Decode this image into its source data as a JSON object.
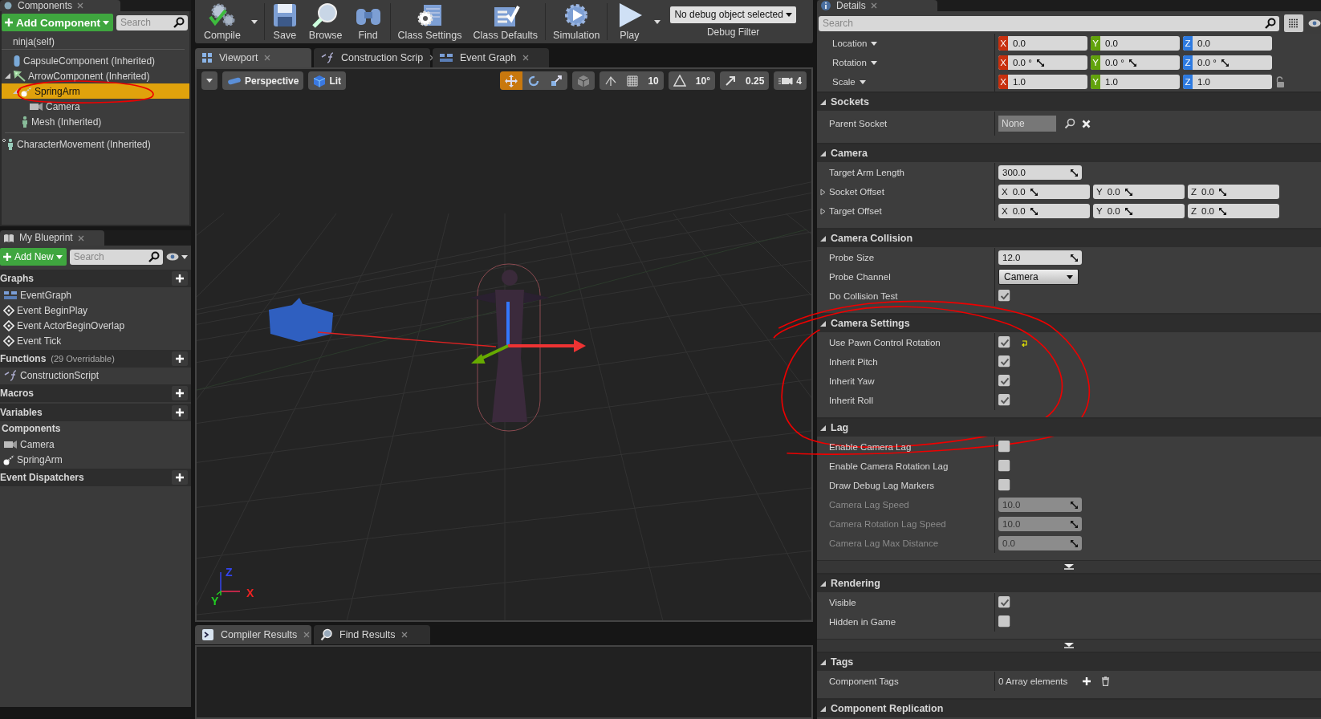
{
  "components_panel": {
    "tab": "Components",
    "add_button": "Add Component",
    "search": {
      "placeholder": "Search"
    },
    "self_item": "ninja(self)",
    "tree": [
      {
        "label": "CapsuleComponent (Inherited)",
        "kind": "capsule",
        "selected": false,
        "circled": false
      },
      {
        "label": "ArrowComponent (Inherited)",
        "kind": "arrow",
        "selected": false,
        "circled": false,
        "children": [
          {
            "label": "SpringArm",
            "kind": "spring",
            "selected": true,
            "circled": true,
            "children": [
              {
                "label": "Camera",
                "kind": "camera",
                "selected": false,
                "circled": false
              }
            ]
          },
          {
            "label": "Mesh (Inherited)",
            "kind": "mesh",
            "selected": false,
            "circled": false
          }
        ]
      }
    ],
    "extra_items": [
      {
        "label": "CharacterMovement (Inherited)",
        "kind": "movement"
      }
    ]
  },
  "my_blueprint": {
    "tab": "My Blueprint",
    "add_button": "Add New",
    "search": {
      "placeholder": "Search"
    },
    "sections": [
      {
        "title": "Graphs",
        "add": true,
        "items": [
          {
            "label": "EventGraph",
            "kind": "graph"
          },
          {
            "label": "Event BeginPlay",
            "kind": "event"
          },
          {
            "label": "Event ActorBeginOverlap",
            "kind": "event"
          },
          {
            "label": "Event Tick",
            "kind": "event"
          }
        ]
      },
      {
        "title": "Functions",
        "note": "(29 Overridable)",
        "add": true,
        "items": [
          {
            "label": "ConstructionScript",
            "kind": "function"
          }
        ]
      },
      {
        "title": "Macros",
        "add": true
      },
      {
        "title": "Variables",
        "add": true,
        "subsections": [
          {
            "title": "Components",
            "items": [
              {
                "label": "Camera",
                "kind": "camera"
              },
              {
                "label": "SpringArm",
                "kind": "spring"
              }
            ]
          }
        ]
      },
      {
        "title": "Event Dispatchers",
        "add": true
      }
    ]
  },
  "toolbar": {
    "buttons": [
      {
        "label": "Compile",
        "kind": "compile",
        "dropdown": true
      },
      {
        "label": "Save",
        "kind": "save",
        "dropdown": false
      },
      {
        "label": "Browse",
        "kind": "browse",
        "dropdown": false
      },
      {
        "label": "Find",
        "kind": "find",
        "dropdown": false
      },
      {
        "label": "Class Settings",
        "kind": "settings",
        "dropdown": false
      },
      {
        "label": "Class Defaults",
        "kind": "defaults",
        "dropdown": false
      },
      {
        "label": "Simulation",
        "kind": "simulation",
        "dropdown": false
      },
      {
        "label": "Play",
        "kind": "play",
        "dropdown": true
      }
    ],
    "debug_filter": {
      "value": "No debug object selected",
      "label": "Debug Filter"
    }
  },
  "document_tabs": [
    {
      "label": "Viewport",
      "kind": "viewport",
      "selected": true
    },
    {
      "label": "Construction Scrip",
      "kind": "function",
      "selected": false
    },
    {
      "label": "Event Graph",
      "kind": "graph",
      "selected": false
    }
  ],
  "viewport_toolbar": {
    "view_mode": "Perspective",
    "lighting": "Lit",
    "transform_modes": [
      {
        "kind": "translate",
        "selected": true
      },
      {
        "kind": "rotate",
        "selected": false
      },
      {
        "kind": "scale",
        "selected": false
      }
    ],
    "grid_snap": "10",
    "rotation_snap": "10°",
    "scale_snap": "0.25",
    "camera_speed": "4"
  },
  "viewport": {
    "axes": [
      {
        "label": "Z",
        "color": "#3344ee"
      },
      {
        "label": "X",
        "color": "#ee2222"
      },
      {
        "label": "Y",
        "color": "#22cc22"
      }
    ]
  },
  "bottom_tabs": [
    {
      "label": "Compiler Results",
      "kind": "compiler",
      "selected": true
    },
    {
      "label": "Find Results",
      "kind": "find",
      "selected": false
    }
  ],
  "details": {
    "tab": "Details",
    "search": {
      "placeholder": "Search"
    },
    "transform": [
      {
        "label": "Location",
        "kind": "plain",
        "fields": [
          {
            "axis": "X",
            "value": "0.0"
          },
          {
            "axis": "Y",
            "value": "0.0"
          },
          {
            "axis": "Z",
            "value": "0.0"
          }
        ]
      },
      {
        "label": "Rotation",
        "kind": "spin",
        "fields": [
          {
            "axis": "X",
            "value": "0.0 °"
          },
          {
            "axis": "Y",
            "value": "0.0 °"
          },
          {
            "axis": "Z",
            "value": "0.0 °"
          }
        ]
      },
      {
        "label": "Scale",
        "kind": "lock",
        "fields": [
          {
            "axis": "X",
            "value": "1.0"
          },
          {
            "axis": "Y",
            "value": "1.0"
          },
          {
            "axis": "Z",
            "value": "1.0"
          }
        ]
      }
    ],
    "sections": [
      {
        "title": "Sockets",
        "expanded": true,
        "circled": false,
        "advanced": false,
        "rows": [
          {
            "kind": "socket",
            "label": "Parent Socket",
            "value": "None",
            "disabled": false
          }
        ]
      },
      {
        "title": "Camera",
        "expanded": true,
        "circled": false,
        "advanced": false,
        "rows": [
          {
            "kind": "number",
            "label": "Target Arm Length",
            "value": "300.0",
            "disabled": false
          },
          {
            "kind": "vector",
            "label": "Socket Offset",
            "expanded": false,
            "disabled": false,
            "fields": [
              {
                "axis": "X",
                "value": "0.0"
              },
              {
                "axis": "Y",
                "value": "0.0"
              },
              {
                "axis": "Z",
                "value": "0.0"
              }
            ]
          },
          {
            "kind": "vector",
            "label": "Target Offset",
            "expanded": false,
            "disabled": false,
            "fields": [
              {
                "axis": "X",
                "value": "0.0"
              },
              {
                "axis": "Y",
                "value": "0.0"
              },
              {
                "axis": "Z",
                "value": "0.0"
              }
            ]
          }
        ]
      },
      {
        "title": "Camera Collision",
        "expanded": true,
        "circled": false,
        "advanced": false,
        "rows": [
          {
            "kind": "number",
            "label": "Probe Size",
            "value": "12.0",
            "disabled": false
          },
          {
            "kind": "dropdown",
            "label": "Probe Channel",
            "value": "Camera",
            "disabled": false
          },
          {
            "kind": "checkbox",
            "label": "Do Collision Test",
            "checked": true,
            "modified": false,
            "disabled": false
          }
        ]
      },
      {
        "title": "Camera Settings",
        "expanded": true,
        "circled": true,
        "advanced": false,
        "rows": [
          {
            "kind": "checkbox",
            "label": "Use Pawn Control Rotation",
            "checked": true,
            "modified": true,
            "disabled": false
          },
          {
            "kind": "checkbox",
            "label": "Inherit Pitch",
            "checked": true,
            "modified": false,
            "disabled": false
          },
          {
            "kind": "checkbox",
            "label": "Inherit Yaw",
            "checked": true,
            "modified": false,
            "disabled": false
          },
          {
            "kind": "checkbox",
            "label": "Inherit Roll",
            "checked": true,
            "modified": false,
            "disabled": false
          }
        ]
      },
      {
        "title": "Lag",
        "expanded": true,
        "circled": false,
        "advanced": true,
        "rows": [
          {
            "kind": "checkbox",
            "label": "Enable Camera Lag",
            "checked": false,
            "modified": false,
            "disabled": false
          },
          {
            "kind": "checkbox",
            "label": "Enable Camera Rotation Lag",
            "checked": false,
            "modified": false,
            "disabled": false
          },
          {
            "kind": "checkbox",
            "label": "Draw Debug Lag Markers",
            "checked": false,
            "modified": false,
            "disabled": false
          },
          {
            "kind": "number",
            "label": "Camera Lag Speed",
            "value": "10.0",
            "disabled": true
          },
          {
            "kind": "number",
            "label": "Camera Rotation Lag Speed",
            "value": "10.0",
            "disabled": true
          },
          {
            "kind": "number",
            "label": "Camera Lag Max Distance",
            "value": "0.0",
            "disabled": true
          }
        ]
      },
      {
        "title": "Rendering",
        "expanded": true,
        "circled": false,
        "advanced": true,
        "rows": [
          {
            "kind": "checkbox",
            "label": "Visible",
            "checked": true,
            "modified": false,
            "disabled": false
          },
          {
            "kind": "checkbox",
            "label": "Hidden in Game",
            "checked": false,
            "modified": false,
            "disabled": false
          }
        ]
      },
      {
        "title": "Tags",
        "expanded": true,
        "circled": false,
        "advanced": false,
        "rows": [
          {
            "kind": "array",
            "label": "Component Tags",
            "value": "0 Array elements",
            "disabled": false
          }
        ]
      },
      {
        "title": "Component Replication",
        "expanded": true,
        "circled": false,
        "advanced": false
      }
    ]
  }
}
